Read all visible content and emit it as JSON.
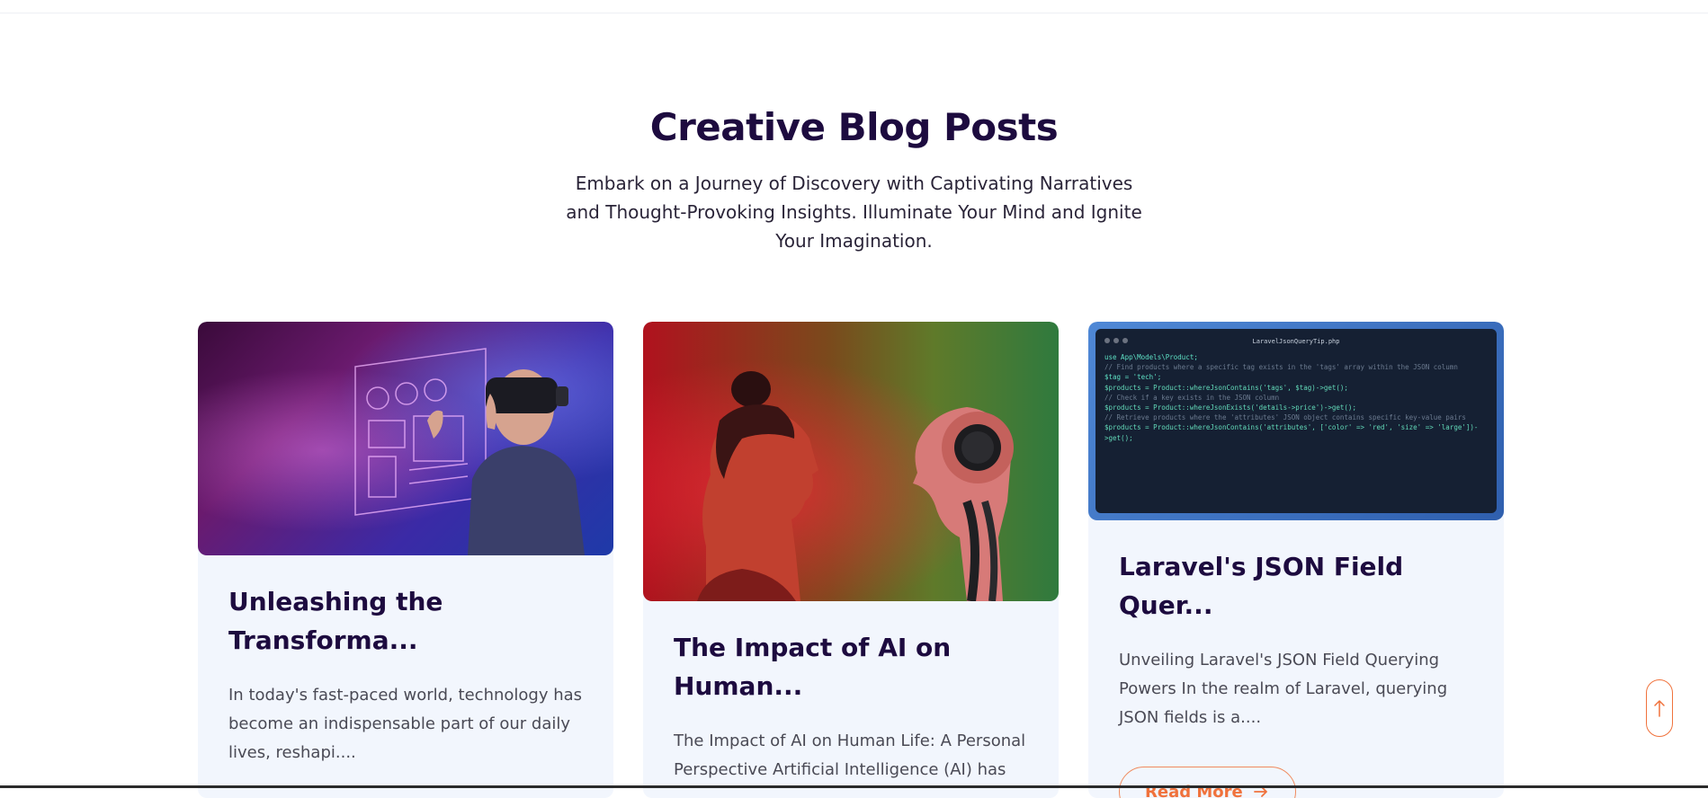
{
  "section": {
    "title": "Creative Blog Posts",
    "subtitle": "Embark on a Journey of Discovery with Captivating Narratives and Thought-Provoking Insights. Illuminate Your Mind and Ignite Your Imagination."
  },
  "posts": [
    {
      "title": "Unleashing the Transforma...",
      "excerpt": "In today's fast-paced world, technology has become an indispensable part of our daily lives, reshapi....",
      "image": "vr-headset-hologram-image"
    },
    {
      "title": "The Impact of AI on Human...",
      "excerpt": "The Impact of AI on Human Life: A Personal Perspective Artificial Intelligence (AI) has",
      "image": "woman-facing-robot-image"
    },
    {
      "title": "Laravel's JSON Field Quer...",
      "excerpt": "Unveiling Laravel's JSON Field Querying Powers In the realm of Laravel, querying JSON fields is a....",
      "image": "code-screenshot-image",
      "read_more": "Read More",
      "code": {
        "filename": "LaravelJsonQueryTip.php",
        "lines": [
          "use App\\Models\\Product;",
          "",
          "// Find products where a specific tag exists in the 'tags' array within the JSON column",
          "$tag = 'tech';",
          "$products = Product::whereJsonContains('tags', $tag)->get();",
          "",
          "// Check if a key exists in the JSON column",
          "$products = Product::whereJsonExists('details->price')->get();",
          "",
          "// Retrieve products where the 'attributes' JSON object contains specific key-value pairs",
          "$products = Product::whereJsonContains('attributes', ['color' => 'red', 'size' => 'large'])-",
          ">get();"
        ]
      }
    }
  ],
  "icons": {
    "read_more_arrow": "arrow-right-icon",
    "scroll_top": "arrow-up-icon"
  },
  "colors": {
    "heading": "#1d0b3f",
    "accent": "#f0723c",
    "card_bg": "#f2f6fd"
  }
}
